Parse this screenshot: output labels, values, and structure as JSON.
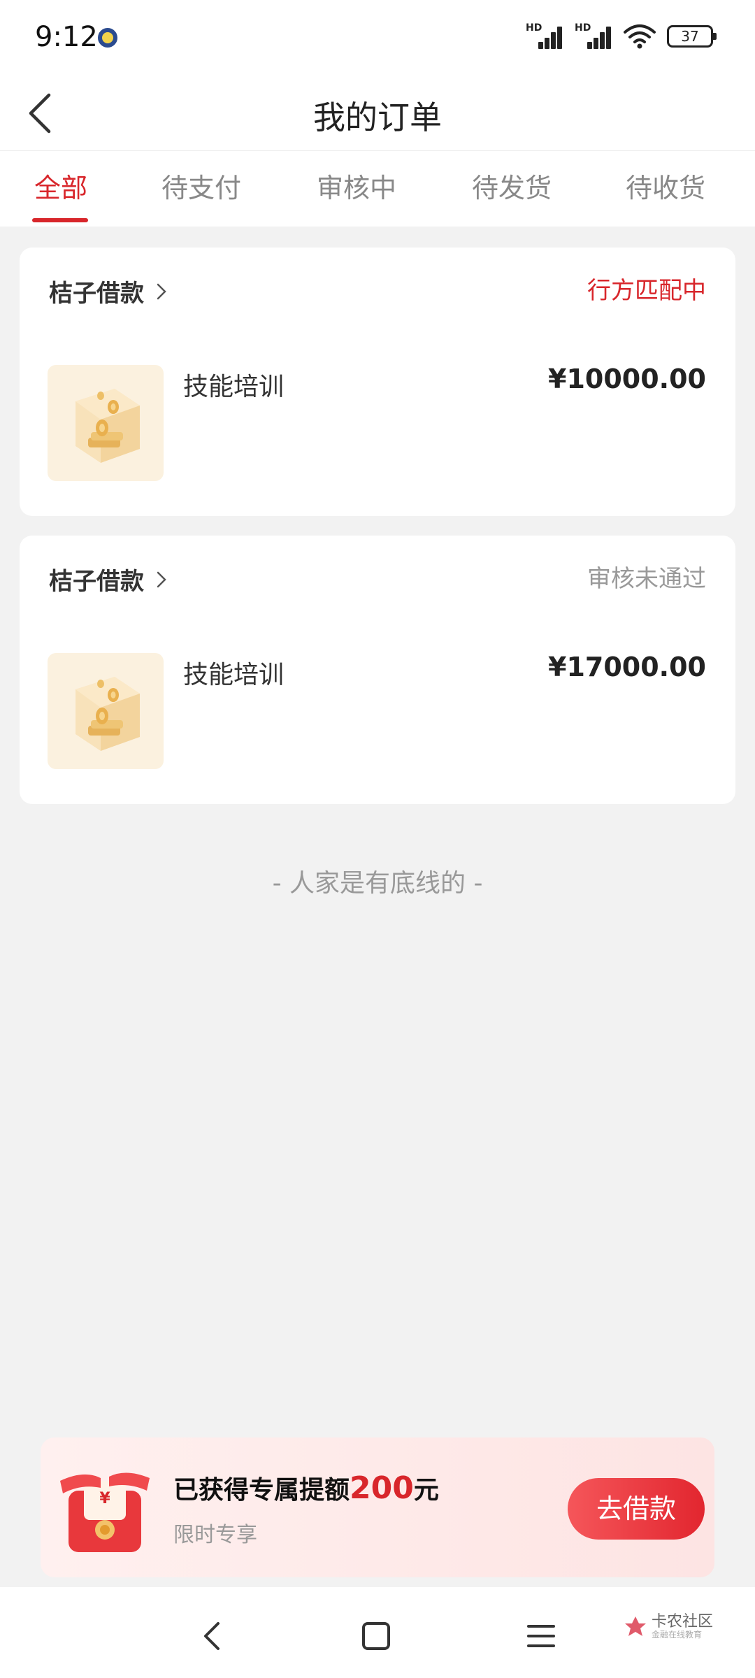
{
  "status_bar": {
    "time": "9:12",
    "network_1": "HD",
    "network_2": "HD",
    "battery": "37"
  },
  "header": {
    "title": "我的订单",
    "back_icon": "chevron-left-icon"
  },
  "tabs": [
    {
      "label": "全部",
      "active": true
    },
    {
      "label": "待支付",
      "active": false
    },
    {
      "label": "审核中",
      "active": false
    },
    {
      "label": "待发货",
      "active": false
    },
    {
      "label": "待收货",
      "active": false
    }
  ],
  "orders": [
    {
      "merchant": "桔子借款",
      "status": "行方匹配中",
      "status_color": "#d8262b",
      "product": "技能培训",
      "price": "¥10000.00"
    },
    {
      "merchant": "桔子借款",
      "status": "审核未通过",
      "status_color": "#999999",
      "product": "技能培训",
      "price": "¥17000.00"
    }
  ],
  "list_end_text": "- 人家是有底线的 -",
  "promo": {
    "title_prefix": "已获得专属提额",
    "amount": "200",
    "unit": "元",
    "subtitle": "限时专享",
    "button": "去借款",
    "gift_symbol": "¥"
  },
  "watermark": {
    "main": "卡农社区",
    "sub": "金融在线教育"
  },
  "colors": {
    "accent": "#d8262b",
    "background": "#f2f2f2"
  }
}
